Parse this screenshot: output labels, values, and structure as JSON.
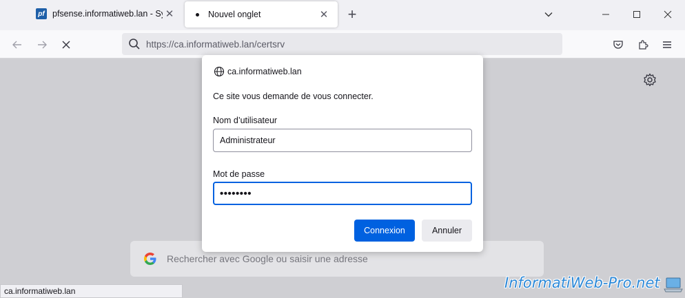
{
  "tabs": [
    {
      "title": "pfsense.informatiweb.lan - Syst",
      "icon": "pfsense-icon",
      "icon_text": "pf",
      "active": false
    },
    {
      "title": "Nouvel onglet",
      "icon": "dot-icon",
      "active": true
    }
  ],
  "toolbar": {
    "url": "https://ca.informatiweb.lan/certsrv"
  },
  "dialog": {
    "host": "ca.informatiweb.lan",
    "message": "Ce site vous demande de vous connecter.",
    "username_label": "Nom d’utilisateur",
    "username_value": "Administrateur",
    "password_label": "Mot de passe",
    "password_value": "••••••••",
    "login_button": "Connexion",
    "cancel_button": "Annuler"
  },
  "newtab": {
    "search_placeholder": "Rechercher avec Google ou saisir une adresse"
  },
  "statusbar": {
    "text": "ca.informatiweb.lan"
  },
  "watermark": {
    "text": "InformatiWeb-Pro.net"
  },
  "colors": {
    "accent": "#0061e0",
    "watermark": "#2d89d8"
  }
}
